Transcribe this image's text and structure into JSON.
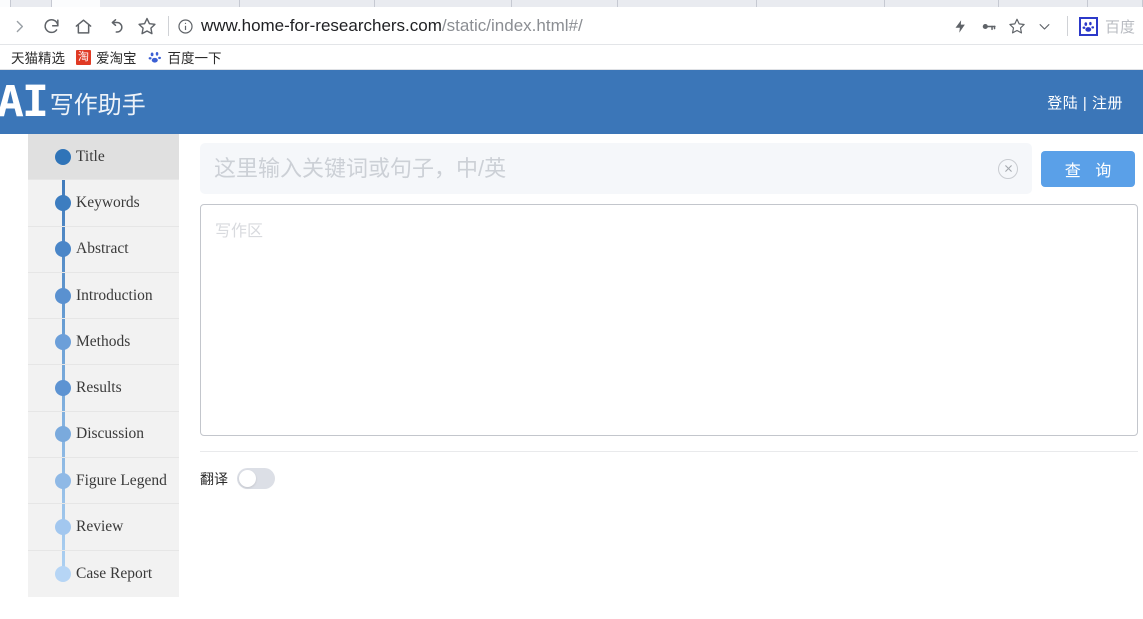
{
  "browser": {
    "tabs_count": 9,
    "nav_icons": [
      "forward-arrow",
      "reload",
      "home",
      "back-undo",
      "bookmark-star"
    ],
    "url": {
      "security_icon": "info-circle",
      "domain": "www.home-for-researchers.com",
      "path": "/static/index.html#/"
    },
    "toolbar_right_icons": [
      "lightning-icon",
      "key-icon",
      "star-icon",
      "chevron-down-icon"
    ],
    "extension": {
      "icon": "baidu-paw-icon",
      "label": "百度"
    },
    "bookmarks": [
      {
        "label": "天猫精选",
        "icon": "tmall-icon"
      },
      {
        "label": "爱淘宝",
        "icon": "taobao-icon"
      },
      {
        "label": "百度一下",
        "icon": "baidu-paw-icon"
      }
    ]
  },
  "header": {
    "logo_ai": "AI",
    "logo_cn": "写作助手",
    "auth": "登陆 | 注册",
    "bg_color": "#3b76b8"
  },
  "sidebar": {
    "items": [
      {
        "label": "Title",
        "dot_color": "#3074b8",
        "active": true
      },
      {
        "label": "Keywords",
        "dot_color": "#3d7dc0",
        "active": false
      },
      {
        "label": "Abstract",
        "dot_color": "#4a86c8",
        "active": false
      },
      {
        "label": "Introduction",
        "dot_color": "#5a91d0",
        "active": false
      },
      {
        "label": "Methods",
        "dot_color": "#6c9fd9",
        "active": false
      },
      {
        "label": "Results",
        "dot_color": "#5d93d2",
        "active": false
      },
      {
        "label": "Discussion",
        "dot_color": "#7aaadd",
        "active": false
      },
      {
        "label": "Figure Legend",
        "dot_color": "#8fb9e6",
        "active": false
      },
      {
        "label": "Review",
        "dot_color": "#a2c7ef",
        "active": false
      },
      {
        "label": "Case Report",
        "dot_color": "#b6d5f5",
        "active": false
      }
    ]
  },
  "main": {
    "search": {
      "value": "",
      "placeholder": "这里输入关键词或句子，中/英",
      "clear_icon": "clear-circle-x-icon",
      "button_label": "查 询",
      "button_color": "#5aa0e8"
    },
    "editor": {
      "value": "",
      "placeholder": "写作区"
    },
    "translate_toggle": {
      "label": "翻译",
      "state": "off"
    }
  }
}
